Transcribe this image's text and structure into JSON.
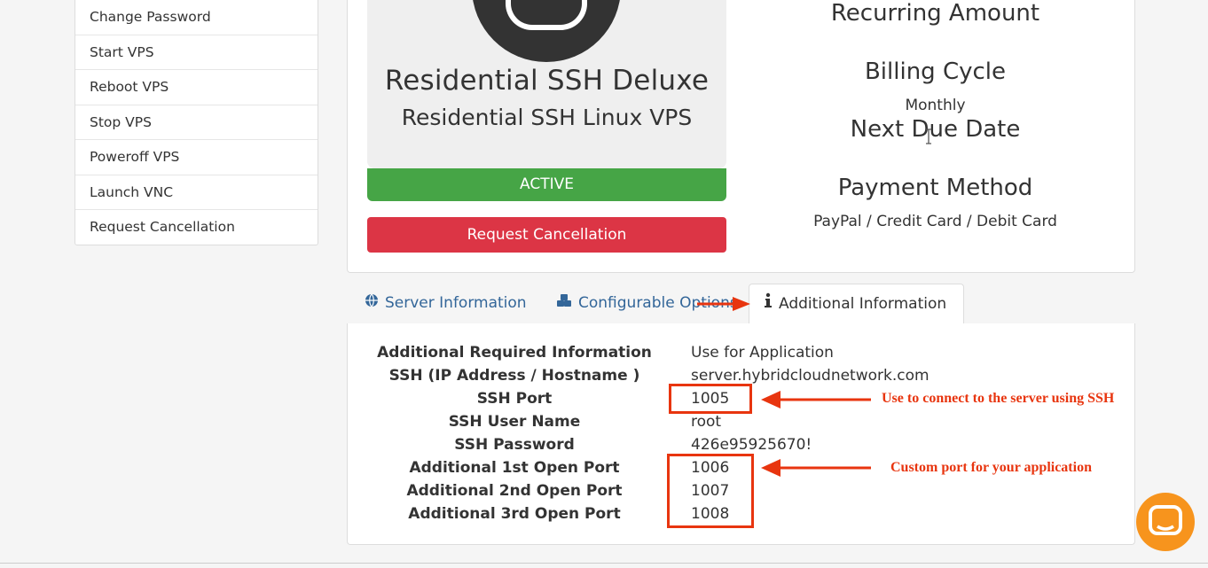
{
  "sidebar": {
    "items": [
      {
        "label": "Change Password"
      },
      {
        "label": "Start VPS"
      },
      {
        "label": "Reboot VPS"
      },
      {
        "label": "Stop VPS"
      },
      {
        "label": "Poweroff VPS"
      },
      {
        "label": "Launch VNC"
      },
      {
        "label": "Request Cancellation"
      }
    ]
  },
  "product": {
    "name": "Residential SSH Deluxe",
    "group": "Residential SSH Linux VPS",
    "status": "ACTIVE",
    "cancel_label": "Request Cancellation"
  },
  "billing": {
    "recurring_amount_label": "Recurring Amount",
    "billing_cycle_label": "Billing Cycle",
    "billing_cycle_value": "Monthly",
    "next_due_date_label": "Next Due Date",
    "payment_method_label": "Payment Method",
    "payment_method_value": "PayPal / Credit Card / Debit Card"
  },
  "tabs": [
    {
      "label": "Server Information",
      "icon": "globe-icon"
    },
    {
      "label": "Configurable Options",
      "icon": "cubes-icon"
    },
    {
      "label": "Additional Information",
      "icon": "info-icon"
    }
  ],
  "info": {
    "rows": [
      {
        "label": "Additional Required Information",
        "value": "Use for Application"
      },
      {
        "label": "SSH (IP Address / Hostname )",
        "value": "server.hybridcloudnetwork.com"
      },
      {
        "label": "SSH Port",
        "value": "1005"
      },
      {
        "label": "SSH User Name",
        "value": "root"
      },
      {
        "label": "SSH Password",
        "value": "426e95925670!"
      },
      {
        "label": "Additional 1st Open Port",
        "value": "1006"
      },
      {
        "label": "Additional 2nd Open Port",
        "value": "1007"
      },
      {
        "label": "Additional 3rd Open Port",
        "value": "1008"
      }
    ]
  },
  "annotations": {
    "ssh_note": "Use to connect to the server using SSH",
    "ports_note": "Custom port for your application",
    "color": "#e8350f"
  },
  "colors": {
    "active_green": "#46a546",
    "cancel_red": "#dc3545",
    "link_blue": "#336699",
    "chat_orange": "#f7941d"
  }
}
